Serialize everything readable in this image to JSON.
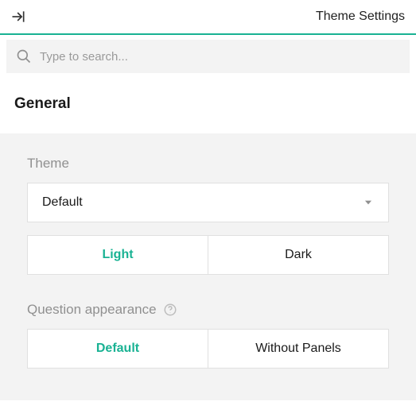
{
  "header": {
    "title": "Theme Settings"
  },
  "search": {
    "placeholder": "Type to search..."
  },
  "section": {
    "title": "General"
  },
  "theme": {
    "label": "Theme",
    "dropdown_value": "Default",
    "options": {
      "a": "Light",
      "b": "Dark"
    },
    "selected": "a"
  },
  "question_appearance": {
    "label": "Question appearance",
    "options": {
      "a": "Default",
      "b": "Without Panels"
    },
    "selected": "a"
  }
}
